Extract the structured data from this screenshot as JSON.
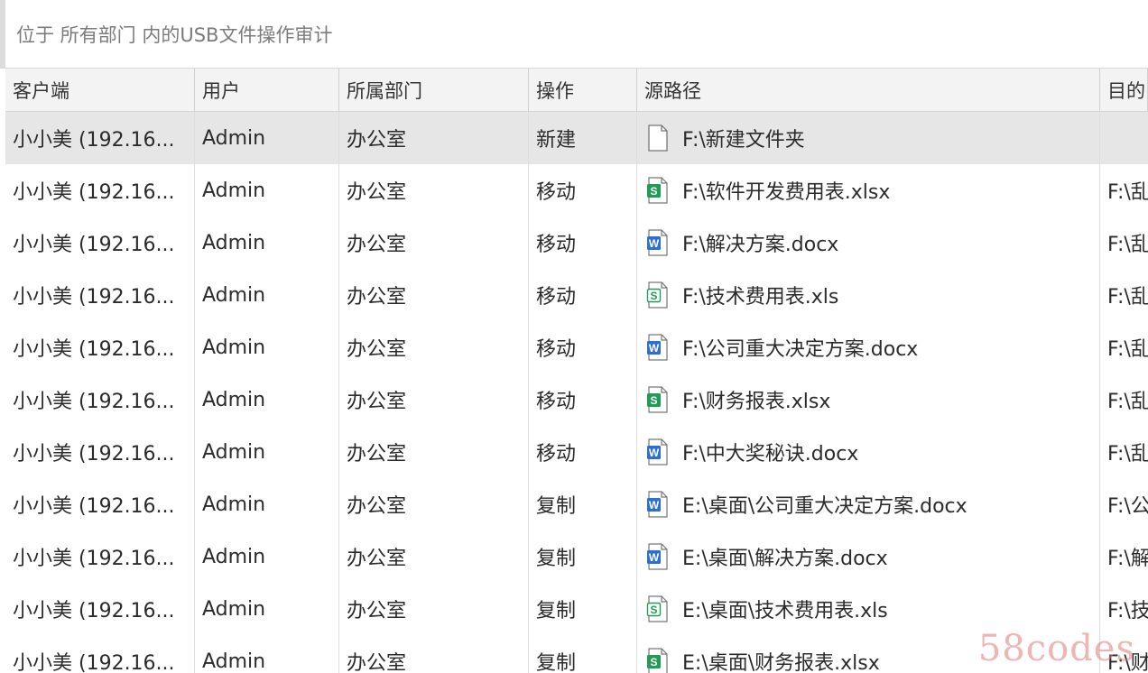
{
  "title": "位于 所有部门 内的USB文件操作审计",
  "columns": [
    "客户端",
    "用户",
    "所属部门",
    "操作",
    "源路径",
    "目的"
  ],
  "rows": [
    {
      "client": "小小美 (192.16...",
      "user": "Admin",
      "dept": "办公室",
      "op": "新建",
      "icon": "blank-file-icon",
      "src": "F:\\新建文件夹",
      "dst": ""
    },
    {
      "client": "小小美 (192.16...",
      "user": "Admin",
      "dept": "办公室",
      "op": "移动",
      "icon": "xlsx-icon",
      "src": "F:\\软件开发费用表.xlsx",
      "dst": "F:\\乱"
    },
    {
      "client": "小小美 (192.16...",
      "user": "Admin",
      "dept": "办公室",
      "op": "移动",
      "icon": "docx-icon",
      "src": "F:\\解决方案.docx",
      "dst": "F:\\乱"
    },
    {
      "client": "小小美 (192.16...",
      "user": "Admin",
      "dept": "办公室",
      "op": "移动",
      "icon": "xls-icon",
      "src": "F:\\技术费用表.xls",
      "dst": "F:\\乱"
    },
    {
      "client": "小小美 (192.16...",
      "user": "Admin",
      "dept": "办公室",
      "op": "移动",
      "icon": "docx-icon",
      "src": "F:\\公司重大决定方案.docx",
      "dst": "F:\\乱"
    },
    {
      "client": "小小美 (192.16...",
      "user": "Admin",
      "dept": "办公室",
      "op": "移动",
      "icon": "xlsx-icon",
      "src": "F:\\财务报表.xlsx",
      "dst": "F:\\乱"
    },
    {
      "client": "小小美 (192.16...",
      "user": "Admin",
      "dept": "办公室",
      "op": "移动",
      "icon": "docx-icon",
      "src": "F:\\中大奖秘诀.docx",
      "dst": "F:\\乱"
    },
    {
      "client": "小小美 (192.16...",
      "user": "Admin",
      "dept": "办公室",
      "op": "复制",
      "icon": "docx-icon",
      "src": "E:\\桌面\\公司重大决定方案.docx",
      "dst": "F:\\公"
    },
    {
      "client": "小小美 (192.16...",
      "user": "Admin",
      "dept": "办公室",
      "op": "复制",
      "icon": "docx-icon",
      "src": "E:\\桌面\\解决方案.docx",
      "dst": "F:\\解"
    },
    {
      "client": "小小美 (192.16...",
      "user": "Admin",
      "dept": "办公室",
      "op": "复制",
      "icon": "xls-icon",
      "src": "E:\\桌面\\技术费用表.xls",
      "dst": "F:\\技"
    },
    {
      "client": "小小美 (192.16...",
      "user": "Admin",
      "dept": "办公室",
      "op": "复制",
      "icon": "xlsx-icon",
      "src": "E:\\桌面\\财务报表.xlsx",
      "dst": "F:\\财"
    }
  ],
  "selected_row": 0,
  "colors": {
    "xlsx_green": "#1f9d55",
    "docx_blue": "#2b6fd6",
    "xls_green_outline": "#1f9d55",
    "selected_bg": "#e6e6e6",
    "header_bg": "#f3f3f3"
  },
  "watermark": "58codes"
}
